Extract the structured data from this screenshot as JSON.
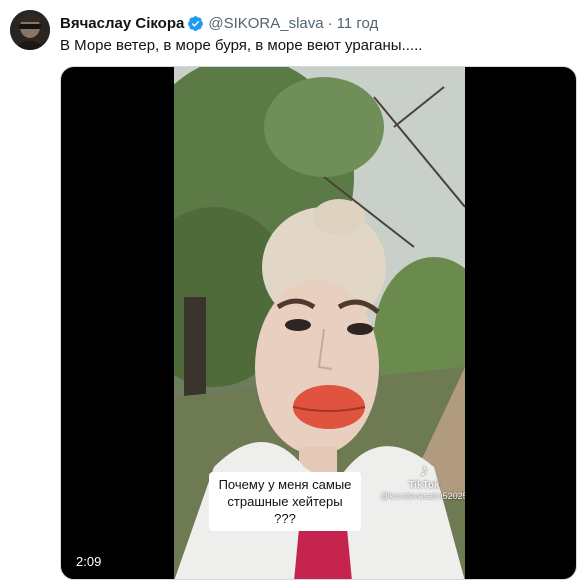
{
  "tweet": {
    "display_name": "Вячаслау Сікора",
    "handle": "@SIKORA_slava",
    "separator": "·",
    "time": "11 год",
    "text": "В Море ветер, в море буря, в море веют ураганы.....",
    "verified_icon": "verified-badge-icon"
  },
  "media": {
    "caption_line1": "Почему у меня самые",
    "caption_line2": "страшные хейтеры ???",
    "watermark_brand": "TikTok",
    "watermark_user": "@korolevasaim52025",
    "duration": "2:09"
  },
  "colors": {
    "text_primary": "#0f1419",
    "text_secondary": "#536471",
    "verified_blue": "#1d9bf0",
    "media_background": "#000000"
  }
}
